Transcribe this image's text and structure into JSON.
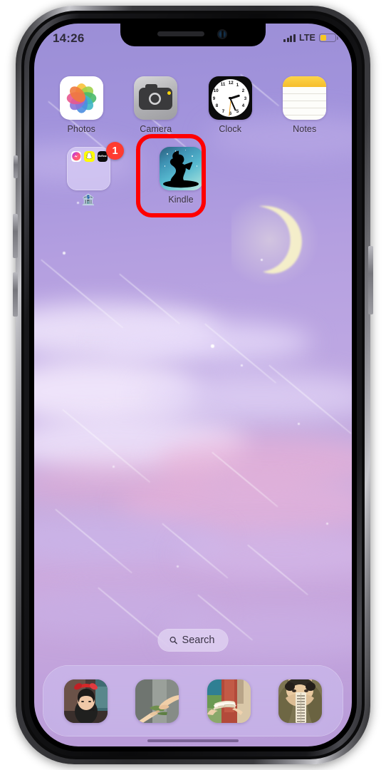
{
  "device": {
    "name": "iPhone",
    "frame_color": "#2a2a2d"
  },
  "status_bar": {
    "time": "14:26",
    "carrier_network": "LTE",
    "signal_icon": "signal-bars-icon",
    "battery_icon": "battery-low-power-icon",
    "battery_color": "#f6c722"
  },
  "wallpaper": {
    "description": "purple pastel night sky with clouds, crescent moon and shooting stars",
    "sky_top": "#9b8ed6",
    "sky_bottom": "#b79ad8",
    "cloud_pink": "#e8a9cf",
    "moon_color": "#f7f1c4"
  },
  "home_screen": {
    "rows": [
      {
        "apps": [
          {
            "name": "Photos",
            "label": "Photos",
            "icon": "photos-icon"
          },
          {
            "name": "Camera",
            "label": "Camera",
            "icon": "camera-icon"
          },
          {
            "name": "Clock",
            "label": "Clock",
            "icon": "clock-icon"
          },
          {
            "name": "Notes",
            "label": "Notes",
            "icon": "notes-icon"
          }
        ]
      },
      {
        "apps": [
          {
            "name": "Social folder",
            "label": "🏦",
            "icon": "folder-icon",
            "badge": "1",
            "badge_color": "#ff3b30",
            "mini_apps": [
              "Messenger",
              "Snapchat",
              "BeReal"
            ],
            "bereal_label": "BeReal"
          },
          {
            "name": "Kindle",
            "label": "Kindle",
            "icon": "kindle-icon",
            "highlighted": true,
            "highlight_color": "#ff0000"
          }
        ]
      }
    ]
  },
  "search": {
    "label": "Search",
    "icon": "search-icon"
  },
  "dock": {
    "items": [
      {
        "name": "dock-app-1",
        "icon": "kiki-custom-icon"
      },
      {
        "name": "dock-app-2",
        "icon": "hands-custom-icon"
      },
      {
        "name": "dock-app-3",
        "icon": "book-custom-icon"
      },
      {
        "name": "dock-app-4",
        "icon": "character-custom-icon"
      }
    ]
  }
}
